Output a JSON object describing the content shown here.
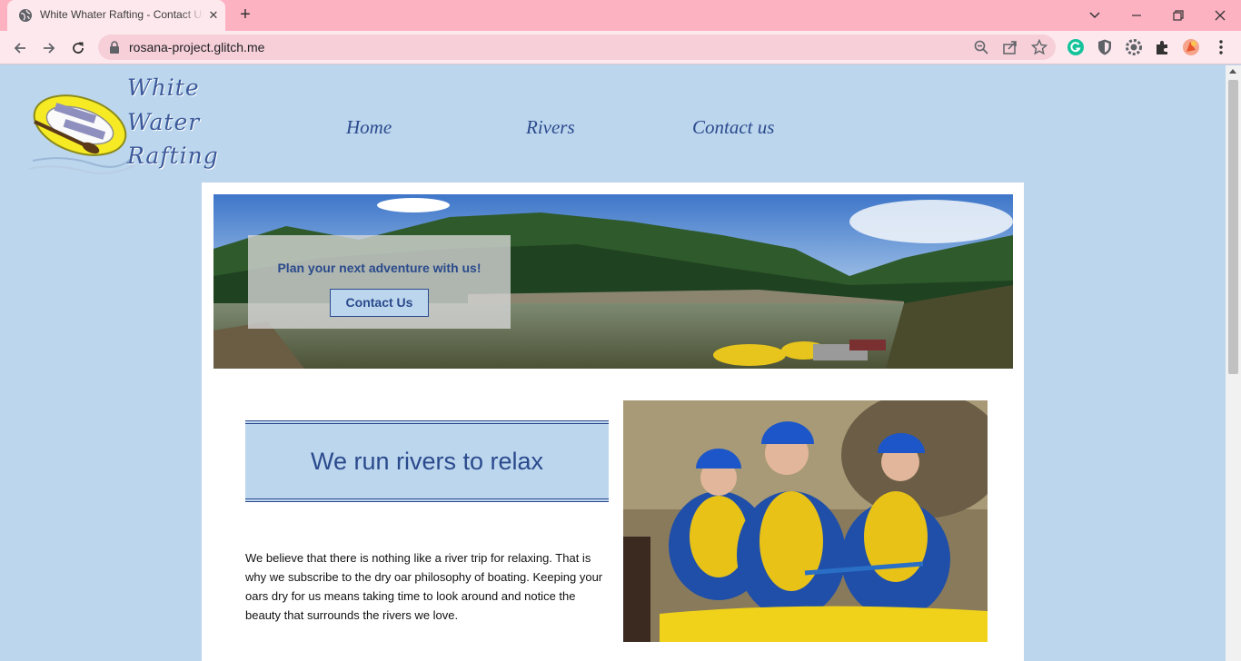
{
  "browser": {
    "tab_title": "White Whater Rafting - Contact Us",
    "url": "rosana-project.glitch.me",
    "new_tab_symbol": "+",
    "close_symbol": "✕"
  },
  "site": {
    "logo_lines": [
      "White",
      "Water",
      "Rafting"
    ],
    "nav": [
      "Home",
      "Rivers",
      "Contact us"
    ]
  },
  "hero": {
    "tagline": "Plan your next adventure with us!",
    "button_label": "Contact Us"
  },
  "section": {
    "heading": "We run rivers to relax",
    "paragraph": "We believe that there is nothing like a river trip for relaxing. That is why we subscribe to the dry oar philosophy of boating. Keeping your oars dry for us means taking time to look around and notice the beauty that surrounds the rivers we love."
  },
  "colors": {
    "page_bg": "#bcd6ee",
    "brand_blue": "#2b4a8c",
    "tab_bar": "#fdb2c2",
    "toolbar": "#fde8ee"
  }
}
